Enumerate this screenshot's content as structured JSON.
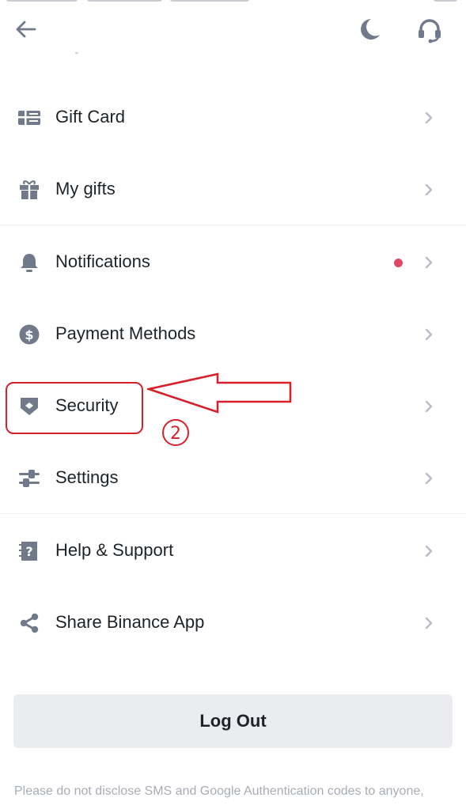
{
  "header": {
    "back_icon": "arrow-left-icon",
    "theme_icon": "moon-icon",
    "support_icon": "headset-icon"
  },
  "menu": {
    "items": [
      {
        "label": "Gift Card",
        "icon": "gift-card-icon"
      },
      {
        "label": "My gifts",
        "icon": "gift-box-icon"
      },
      {
        "label": "Notifications",
        "icon": "bell-icon",
        "has_unread_dot": true
      },
      {
        "label": "Payment Methods",
        "icon": "dollar-circle-icon"
      },
      {
        "label": "Security",
        "icon": "shield-icon"
      },
      {
        "label": "Settings",
        "icon": "sliders-icon"
      },
      {
        "label": "Help & Support",
        "icon": "help-document-icon"
      },
      {
        "label": "Share Binance App",
        "icon": "share-icon"
      }
    ]
  },
  "annotation": {
    "step_number": "2",
    "highlight_color": "#d8202a"
  },
  "logout": {
    "label": "Log Out"
  },
  "footer": {
    "note": "Please do not disclose SMS and Google Authentication codes to anyone,"
  },
  "colors": {
    "text": "#1e2329",
    "icon": "#707a8a",
    "chevron": "#b7bdc6",
    "notification_dot": "#e24866",
    "button_bg": "#eaecef"
  }
}
